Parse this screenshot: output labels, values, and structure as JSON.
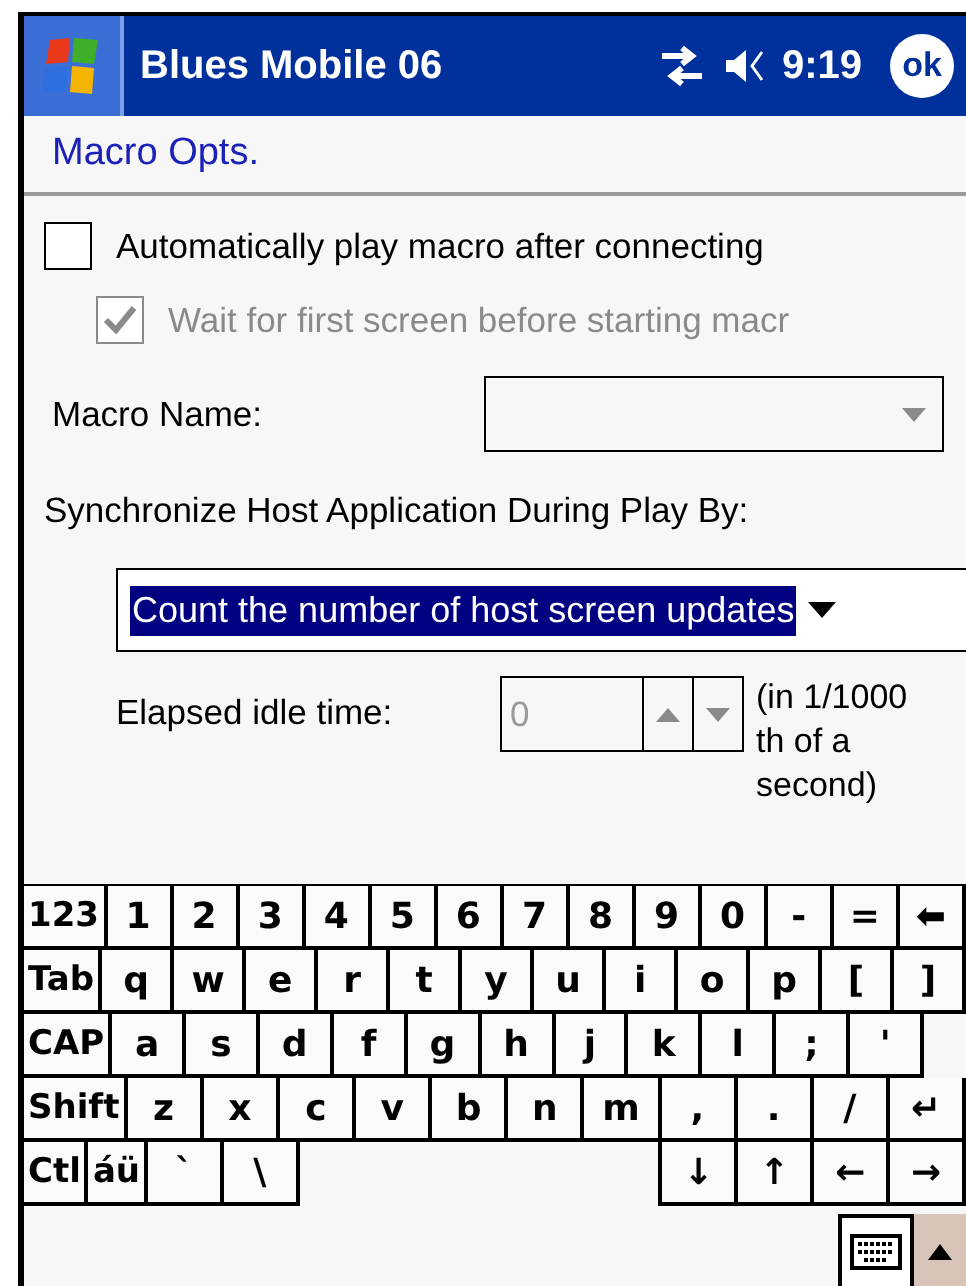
{
  "title_bar": {
    "title": "Blues Mobile 06",
    "time": "9:19",
    "ok_label": "ok"
  },
  "header": {
    "title": "Macro Opts."
  },
  "checkboxes": [
    {
      "label": "Automatically play macro after connecting",
      "checked": false,
      "disabled": false
    },
    {
      "label": "Wait for first screen before starting macr",
      "checked": true,
      "disabled": true
    }
  ],
  "macro_name": {
    "label": "Macro Name:"
  },
  "sync": {
    "label": "Synchronize Host Application During Play By:",
    "value": "Count the number of host screen updates",
    "highlighted": true
  },
  "idle": {
    "label": "Elapsed idle time:",
    "value": "0",
    "disabled": true,
    "unit": "(in 1/1000 th of a second)"
  },
  "keyboard": {
    "number_row": [
      {
        "label": "123",
        "kind": "mod"
      },
      {
        "label": "1",
        "kind": "char"
      },
      {
        "label": "2",
        "kind": "char"
      },
      {
        "label": "3",
        "kind": "char"
      },
      {
        "label": "4",
        "kind": "char"
      },
      {
        "label": "5",
        "kind": "char"
      },
      {
        "label": "6",
        "kind": "char"
      },
      {
        "label": "7",
        "kind": "char"
      },
      {
        "label": "8",
        "kind": "char"
      },
      {
        "label": "9",
        "kind": "char"
      },
      {
        "label": "0",
        "kind": "char"
      },
      {
        "label": "-",
        "kind": "char"
      },
      {
        "label": "=",
        "kind": "char"
      },
      {
        "label": "⬅",
        "kind": "char"
      }
    ],
    "qwerty_row": [
      {
        "label": "Tab",
        "kind": "mod"
      },
      {
        "label": "q",
        "kind": "char"
      },
      {
        "label": "w",
        "kind": "char"
      },
      {
        "label": "e",
        "kind": "char"
      },
      {
        "label": "r",
        "kind": "char"
      },
      {
        "label": "t",
        "kind": "char"
      },
      {
        "label": "y",
        "kind": "char"
      },
      {
        "label": "u",
        "kind": "char"
      },
      {
        "label": "i",
        "kind": "char"
      },
      {
        "label": "o",
        "kind": "char"
      },
      {
        "label": "p",
        "kind": "char"
      },
      {
        "label": "[",
        "kind": "char"
      },
      {
        "label": "]",
        "kind": "char"
      }
    ],
    "home_row": [
      {
        "label": "CAP",
        "kind": "mod"
      },
      {
        "label": "a",
        "kind": "char"
      },
      {
        "label": "s",
        "kind": "char"
      },
      {
        "label": "d",
        "kind": "char"
      },
      {
        "label": "f",
        "kind": "char"
      },
      {
        "label": "g",
        "kind": "char"
      },
      {
        "label": "h",
        "kind": "char"
      },
      {
        "label": "j",
        "kind": "char"
      },
      {
        "label": "k",
        "kind": "char"
      },
      {
        "label": "l",
        "kind": "char"
      },
      {
        "label": ";",
        "kind": "char"
      },
      {
        "label": "'",
        "kind": "char"
      }
    ],
    "shift_row": [
      {
        "label": "Shift",
        "kind": "mod"
      },
      {
        "label": "z",
        "kind": "char"
      },
      {
        "label": "x",
        "kind": "char"
      },
      {
        "label": "c",
        "kind": "char"
      },
      {
        "label": "v",
        "kind": "char"
      },
      {
        "label": "b",
        "kind": "char"
      },
      {
        "label": "n",
        "kind": "char"
      },
      {
        "label": "m",
        "kind": "char"
      },
      {
        "label": ",",
        "kind": "char"
      },
      {
        "label": ".",
        "kind": "char"
      },
      {
        "label": "/",
        "kind": "char"
      },
      {
        "label": "↵",
        "kind": "char"
      }
    ],
    "control_row_left": [
      {
        "label": "Ctl",
        "kind": "mod"
      },
      {
        "label": "áü",
        "kind": "mod"
      },
      {
        "label": "`",
        "kind": "char"
      },
      {
        "label": "\\",
        "kind": "char"
      }
    ],
    "control_row_right": [
      {
        "label": "↓",
        "kind": "char"
      },
      {
        "label": "↑",
        "kind": "char"
      },
      {
        "label": "←",
        "kind": "char"
      },
      {
        "label": "→",
        "kind": "char"
      }
    ]
  }
}
